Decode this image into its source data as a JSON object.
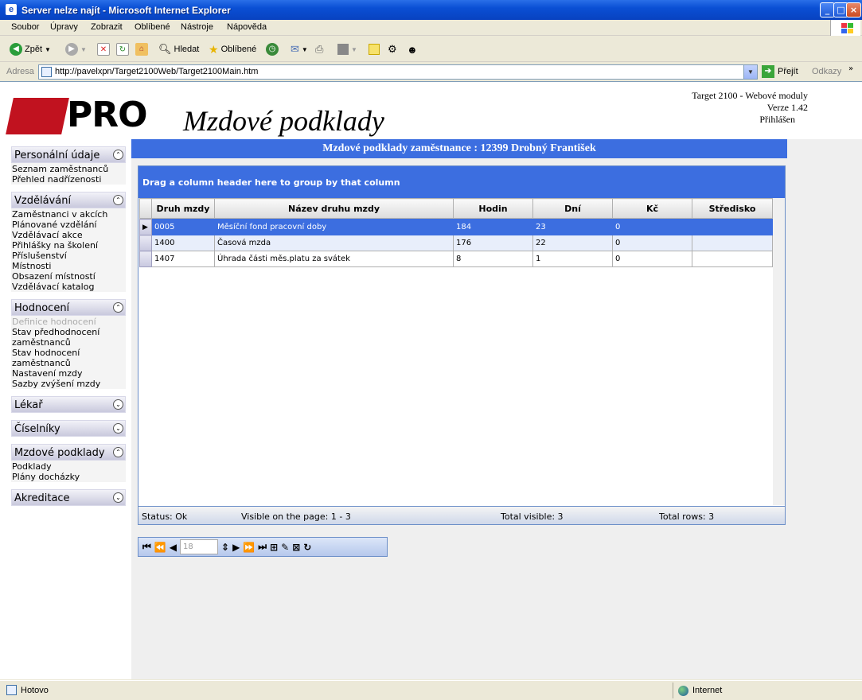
{
  "window": {
    "title": "Server nelze najít - Microsoft Internet Explorer"
  },
  "menu": [
    "Soubor",
    "Úpravy",
    "Zobrazit",
    "Oblíbené",
    "Nástroje",
    "Nápověda"
  ],
  "toolbar": {
    "back": "Zpět",
    "search": "Hledat",
    "favorites": "Oblíbené"
  },
  "address": {
    "label": "Adresa",
    "url": "http://pavelxpn/Target2100Web/Target2100Main.htm",
    "go": "Přejít",
    "links": "Odkazy"
  },
  "header": {
    "logo": "PRO",
    "app_title": "Mzdové podklady",
    "product": "Target 2100 - Webové moduly",
    "version": "Verze 1.42",
    "login": "Přihlášen"
  },
  "sidebar": [
    {
      "title": "Personální údaje",
      "expanded": true,
      "items": [
        "Seznam zaměstnanců",
        "Přehled nadřízenosti"
      ]
    },
    {
      "title": "Vzdělávání",
      "expanded": true,
      "items": [
        "Zaměstnanci v akcích",
        "Plánované vzdělání",
        "Vzdělávací akce",
        "Přihlášky na školení",
        "Příslušenství",
        "Místnosti",
        "Obsazení místností",
        "Vzdělávací katalog"
      ]
    },
    {
      "title": "Hodnocení",
      "expanded": true,
      "items": [
        "Definice hodnocení",
        "Stav předhodnocení zaměstnanců",
        "Stav hodnocení zaměstnanců",
        "Nastavení mzdy",
        "Sazby zvýšení mzdy"
      ]
    },
    {
      "title": "Lékař",
      "expanded": false,
      "items": []
    },
    {
      "title": "Číselníky",
      "expanded": false,
      "items": []
    },
    {
      "title": "Mzdové podklady",
      "expanded": true,
      "items": [
        "Podklady",
        "Plány docházky"
      ]
    },
    {
      "title": "Akreditace",
      "expanded": false,
      "items": []
    }
  ],
  "main": {
    "title": "Mzdové podklady zaměstnance : 12399 Drobný František",
    "group_hint": "Drag a column header here to group by that column",
    "columns": [
      "Druh mzdy",
      "Název druhu mzdy",
      "Hodin",
      "Dní",
      "Kč",
      "Středisko"
    ],
    "rows": [
      [
        "0005",
        "Měsíční fond pracovní doby",
        "184",
        "23",
        "0",
        ""
      ],
      [
        "1400",
        "Časová mzda",
        "176",
        "22",
        "0",
        ""
      ],
      [
        "1407",
        "Úhrada části měs.platu za svátek",
        "8",
        "1",
        "0",
        ""
      ]
    ],
    "status": {
      "status": "Status: Ok",
      "visible": "Visible on the page: 1 - 3",
      "total_visible": "Total visible: 3",
      "total_rows": "Total rows: 3"
    },
    "pager": {
      "page_size": "18"
    }
  },
  "statusbar": {
    "text": "Hotovo",
    "zone": "Internet"
  }
}
